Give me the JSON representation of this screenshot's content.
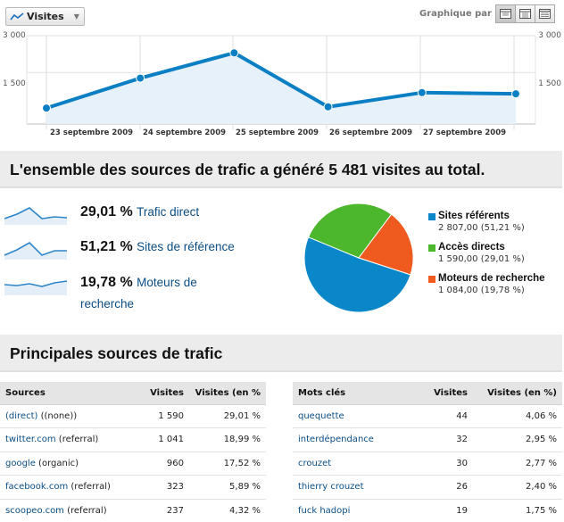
{
  "toolbar": {
    "metric_label": "Visites",
    "graph_by_label": "Graphique par :",
    "view_icons": [
      "day-view-icon",
      "week-view-icon",
      "month-view-icon"
    ]
  },
  "colors": {
    "line": "#0a7fc4",
    "area": "#e7f1fa",
    "sites_referents": "#0a87c8",
    "acces_directs": "#4cb72c",
    "moteurs_recherche": "#ef5b1e"
  },
  "chart_data": [
    {
      "type": "line",
      "series": [
        {
          "values": [
            50,
            1270,
            2300,
            100,
            680,
            630
          ]
        }
      ],
      "x_tick_labels": [
        "23 septembre 2009",
        "24 septembre 2009",
        "25 septembre 2009",
        "26 septembre 2009",
        "27 septembre 2009"
      ],
      "y_tick_labels": [
        "3 000",
        "1 500"
      ],
      "ylim": [
        -600,
        3000
      ],
      "grid": true
    },
    {
      "type": "pie",
      "slices": [
        {
          "label": "Sites référents",
          "value": 2807.0,
          "percent": 51.21
        },
        {
          "label": "Accès directs",
          "value": 1590.0,
          "percent": 29.01
        },
        {
          "label": "Moteurs de recherche",
          "value": 1084.0,
          "percent": 19.78
        }
      ]
    }
  ],
  "summary": {
    "heading": "L'ensemble des sources de trafic a généré 5 481 visites au total.",
    "sources": [
      {
        "pct": "29,01 %",
        "label": "Trafic direct",
        "label_2": "",
        "spark": [
          12,
          7,
          0,
          12,
          10,
          11
        ]
      },
      {
        "pct": "51,21 %",
        "label": "Sites de référence",
        "label_2": "",
        "spark": [
          14,
          8,
          0,
          14,
          9,
          9
        ]
      },
      {
        "pct": "19,78 %",
        "label": "Moteurs de",
        "label_2": "recherche",
        "spark": [
          7,
          8,
          6,
          9,
          5,
          3
        ]
      }
    ]
  },
  "legend": [
    {
      "label": "Sites référents",
      "value": "2 807,00 (51,21 %)"
    },
    {
      "label": "Accès directs",
      "value": "1 590,00 (29,01 %)"
    },
    {
      "label": "Moteurs de recherche",
      "value": "1 084,00 (19,78 %)"
    }
  ],
  "top_sources": {
    "heading": "Principales sources de trafic",
    "sources_table": {
      "headers": [
        "Sources",
        "Visites",
        "Visites (en %"
      ],
      "rows": [
        {
          "link": "(direct)",
          "suffix": " ((none))",
          "visits": "1 590",
          "pct": "29,01 %"
        },
        {
          "link": "twitter.com",
          "suffix": " (referral)",
          "visits": "1 041",
          "pct": "18,99 %"
        },
        {
          "link": "google",
          "suffix": " (organic)",
          "visits": "960",
          "pct": "17,52 %"
        },
        {
          "link": "facebook.com",
          "suffix": " (referral)",
          "visits": "323",
          "pct": "5,89 %"
        },
        {
          "link": "scoopeo.com",
          "suffix": " (referral)",
          "visits": "237",
          "pct": "4,32 %"
        }
      ]
    },
    "keywords_table": {
      "headers": [
        "Mots clés",
        "Visites",
        "Visites (en %)"
      ],
      "rows": [
        {
          "link": "quequette",
          "visits": "44",
          "pct": "4,06 %"
        },
        {
          "link": "interdépendance",
          "visits": "32",
          "pct": "2,95 %"
        },
        {
          "link": "crouzet",
          "visits": "30",
          "pct": "2,77 %"
        },
        {
          "link": "thierry crouzet",
          "visits": "26",
          "pct": "2,40 %"
        },
        {
          "link": "fuck hadopi",
          "visits": "19",
          "pct": "1,75 %"
        }
      ]
    }
  }
}
